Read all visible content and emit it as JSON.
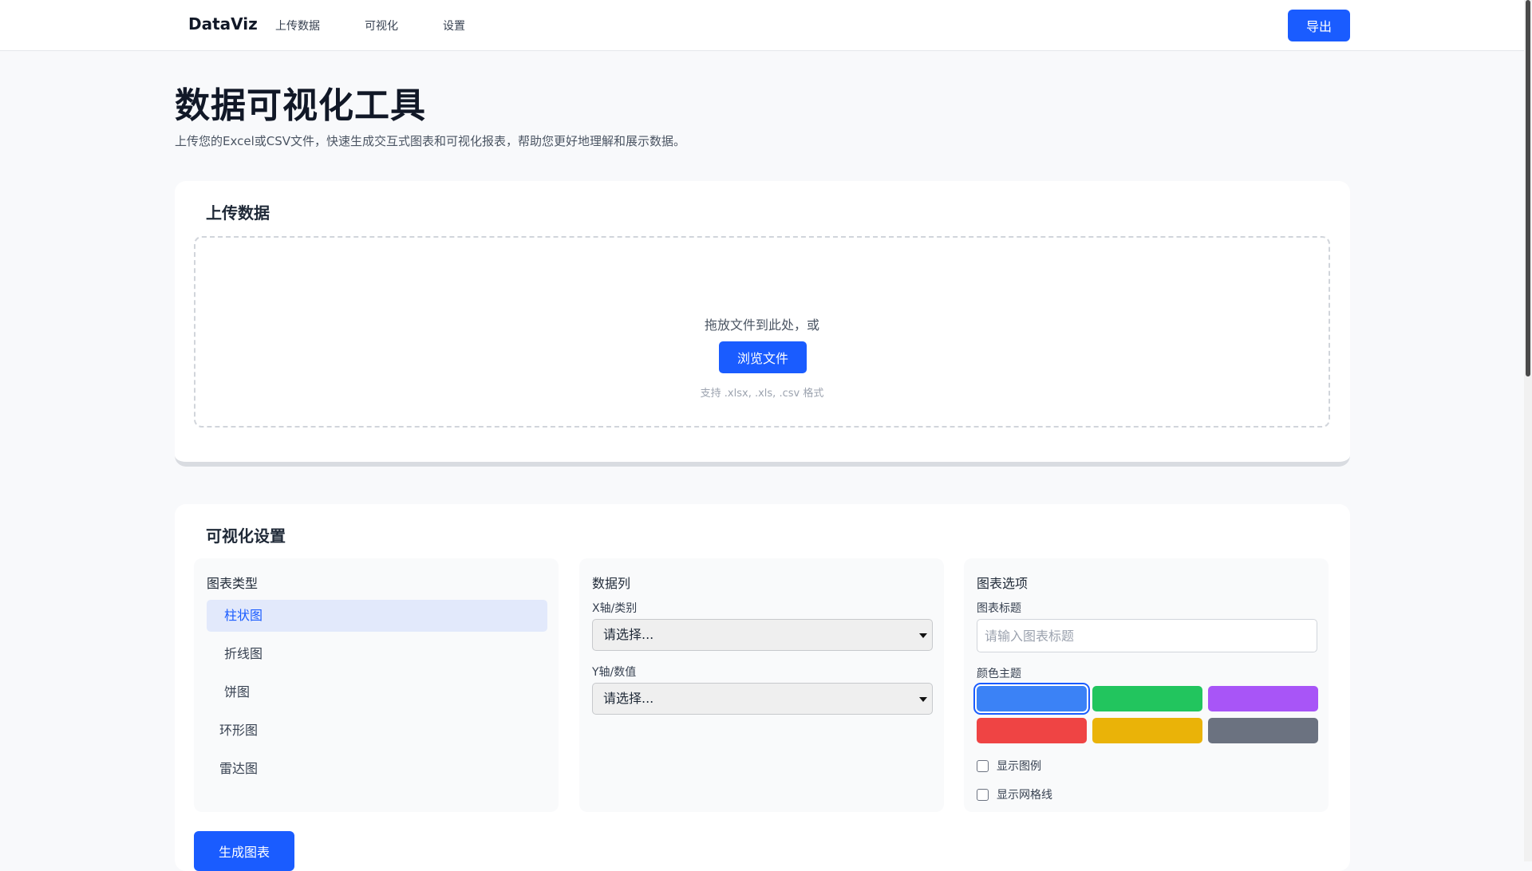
{
  "nav": {
    "brand": "DataViz",
    "links": [
      "上传数据",
      "可视化",
      "设置"
    ],
    "export_label": "导出"
  },
  "header": {
    "title": "数据可视化工具",
    "subtitle": "上传您的Excel或CSV文件，快速生成交互式图表和可视化报表，帮助您更好地理解和展示数据。"
  },
  "upload": {
    "title": "上传数据",
    "drop_text": "拖放文件到此处，或",
    "browse_label": "浏览文件",
    "format_hint": "支持 .xlsx, .xls, .csv 格式"
  },
  "settings": {
    "title": "可视化设置",
    "chart_type_panel": {
      "title": "图表类型",
      "types": [
        "柱状图",
        "折线图",
        "饼图",
        "环形图",
        "雷达图"
      ],
      "active_index": 0
    },
    "columns_panel": {
      "title": "数据列",
      "x_label": "X轴/类别",
      "x_value": "请选择...",
      "y_label": "Y轴/数值",
      "y_value": "请选择..."
    },
    "options_panel": {
      "title": "图表选项",
      "chart_title_label": "图表标题",
      "chart_title_placeholder": "请输入图表标题",
      "chart_title_value": "",
      "color_theme_label": "颜色主题",
      "color_themes": [
        "#3b82f6",
        "#22c55e",
        "#a855f7",
        "#ef4444",
        "#eab308",
        "#6b7280"
      ],
      "selected_theme_index": 0,
      "show_legend_label": "显示图例",
      "show_legend": false,
      "show_grid_label": "显示网格线",
      "show_grid": false
    },
    "generate_label": "生成图表"
  },
  "colors": {
    "accent": "#1a5cff",
    "active_item_bg": "#e2e9fb"
  }
}
